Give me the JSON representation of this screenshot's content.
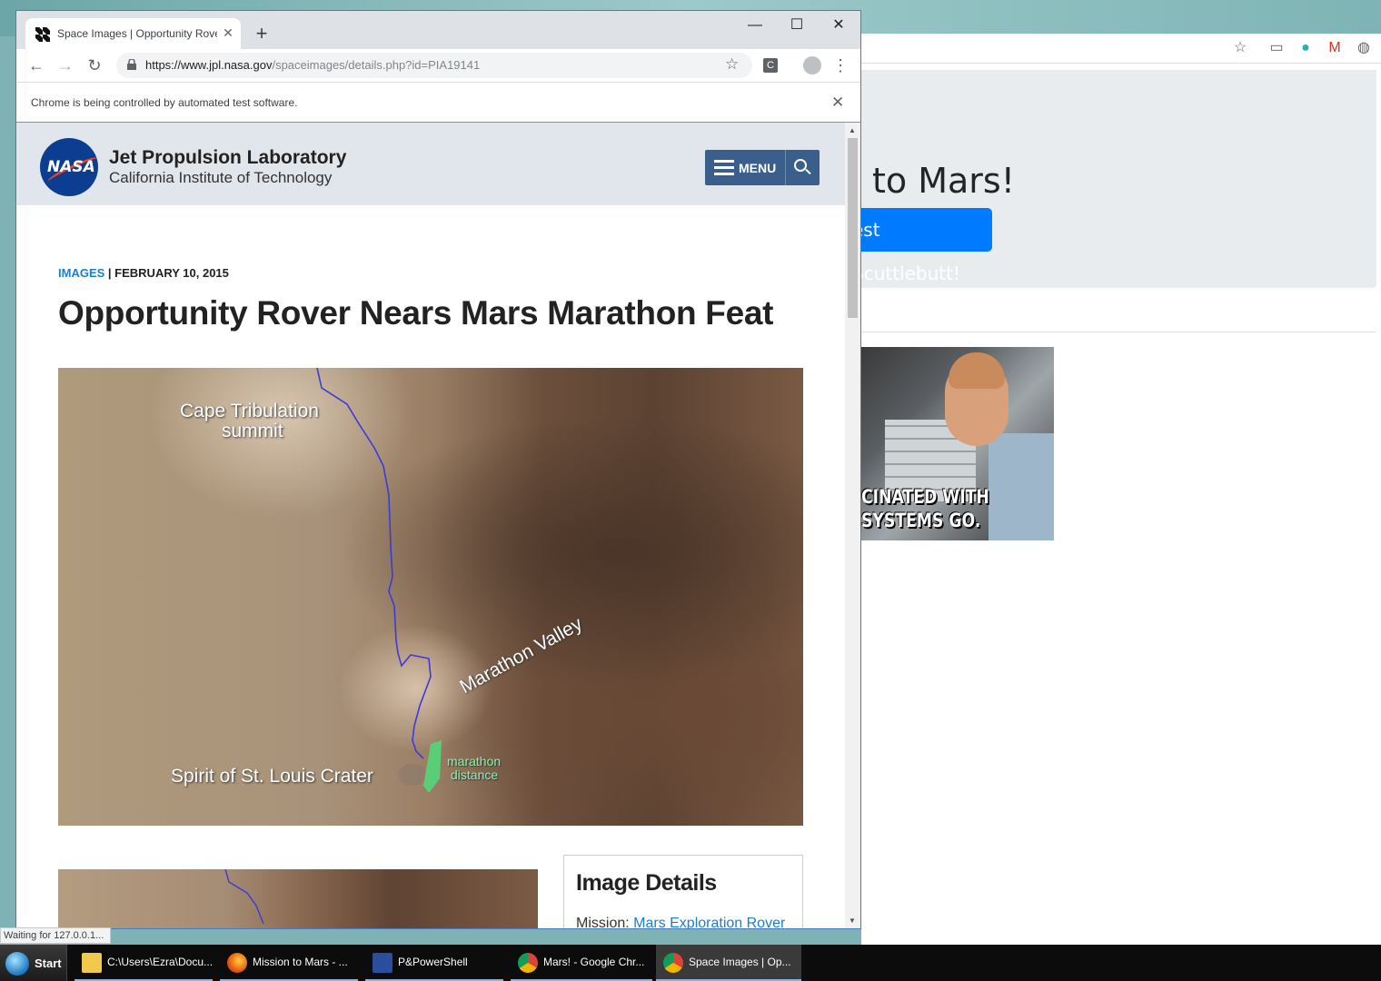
{
  "background_window": {
    "heading": "to Mars!",
    "button_label": "est Scuttlebutt!",
    "gif_caption_line1": "CINATED WITH",
    "gif_caption_line2": "SYSTEMS GO."
  },
  "browser": {
    "tab_title": "Space Images | Opportunity Rove",
    "url_host": "https://www.jpl.nasa.gov",
    "url_path": "/spaceimages/details.php?id=PIA19141",
    "infobar_message": "Chrome is being controlled by automated test software.",
    "extension_label": "C",
    "status_text": "Waiting for 127.0.0.1..."
  },
  "page": {
    "header": {
      "logo_text": "NASA",
      "lab_name": "Jet Propulsion Laboratory",
      "institute": "California Institute of Technology",
      "menu_label": "MENU"
    },
    "category": "IMAGES",
    "separator": " | ",
    "date": "FEBRUARY 10, 2015",
    "title": "Opportunity Rover Nears Mars Marathon Feat",
    "image_labels": {
      "cape": "Cape Tribulation",
      "summit": "summit",
      "valley": "Marathon Valley",
      "crater": "Spirit of St. Louis Crater",
      "marathon": "marathon",
      "distance": "distance"
    },
    "details": {
      "title": "Image Details",
      "mission_label": "Mission: ",
      "mission_value": "Mars Exploration Rover"
    }
  },
  "taskbar": {
    "start_label": "Start",
    "items": [
      {
        "label": "C:\\Users\\Ezra\\Docu...",
        "icon": "folder-icon"
      },
      {
        "label": "Mission to Mars - ...",
        "icon": "firefox-icon"
      },
      {
        "label": "P&PowerShell",
        "icon": "powershell-icon"
      },
      {
        "label": "Mars! - Google Chr...",
        "icon": "chrome-icon"
      },
      {
        "label": "Space Images | Op...",
        "icon": "chrome-icon"
      }
    ]
  },
  "colors": {
    "accent_blue": "#007bff",
    "jpl_link": "#1a7fcf",
    "menu_button": "#3b5f8c",
    "rover_path": "#3b3bd6",
    "marathon_marker": "#4fdc7a"
  }
}
